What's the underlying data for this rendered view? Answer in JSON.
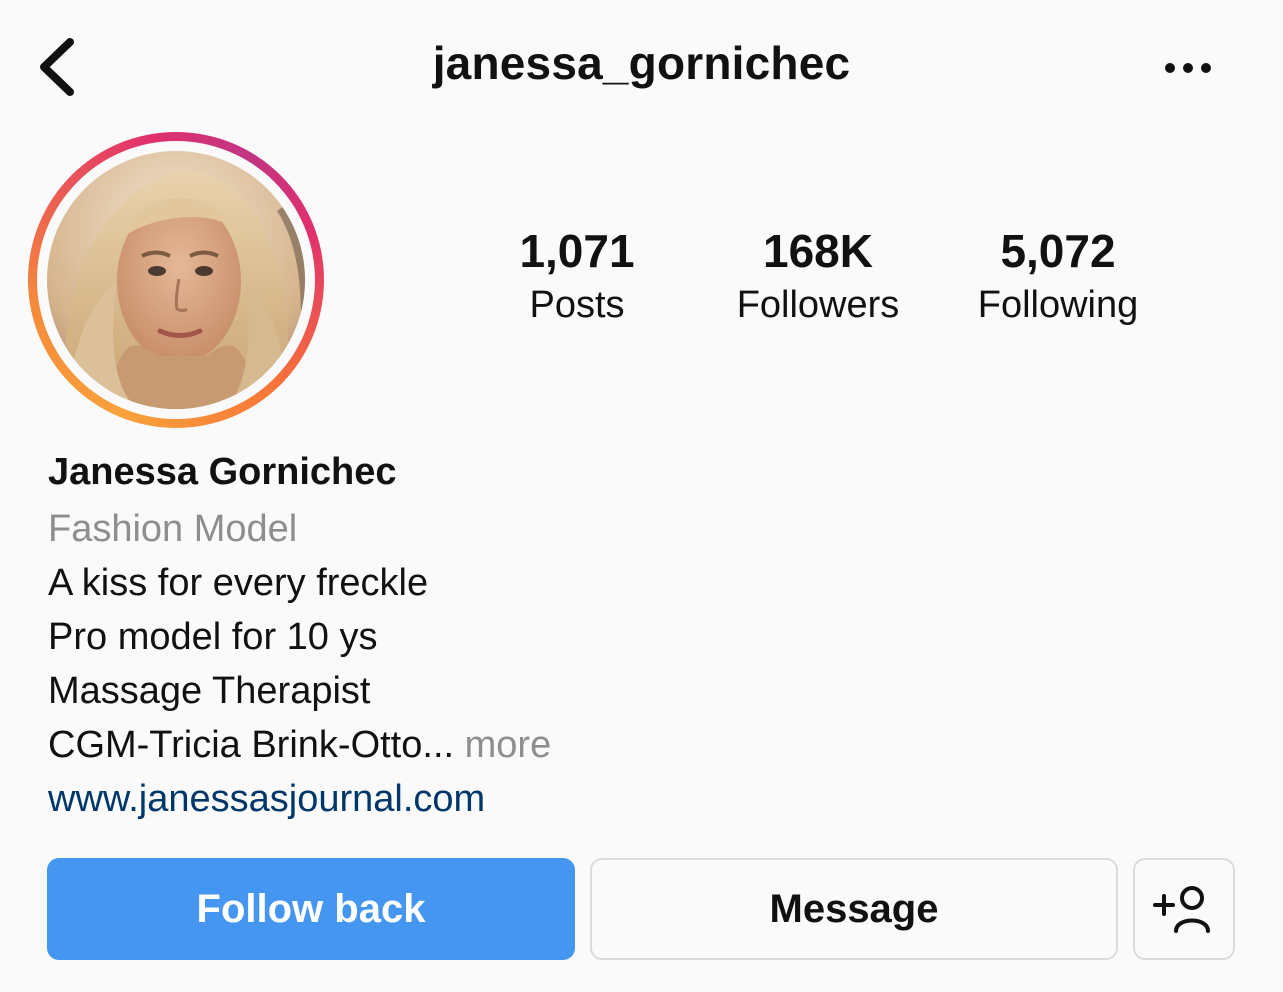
{
  "header": {
    "username": "janessa_gornichec",
    "back_icon": "chevron-left-icon",
    "more_icon": "more-horizontal-icon"
  },
  "profile": {
    "avatar_alt": "profile-photo",
    "ring_colors": [
      "#f9a23c",
      "#e1306c",
      "#c13584"
    ]
  },
  "stats": [
    {
      "value": "1,071",
      "label": "Posts"
    },
    {
      "value": "168K",
      "label": "Followers"
    },
    {
      "value": "5,072",
      "label": "Following"
    }
  ],
  "bio": {
    "name": "Janessa Gornichec",
    "category": "Fashion Model",
    "lines": [
      "A kiss for every freckle",
      "Pro model for 10 ys",
      "Massage Therapist"
    ],
    "truncated_line": "CGM-Tricia Brink-Otto",
    "ellipsis": "...",
    "more": " more",
    "website": "www.janessasjournal.com"
  },
  "actions": {
    "follow_back": "Follow back",
    "message": "Message",
    "add_user_icon": "add-user-icon"
  },
  "colors": {
    "follow_button": "#4596f0",
    "link": "#00376b",
    "muted": "#8e8e8e"
  }
}
